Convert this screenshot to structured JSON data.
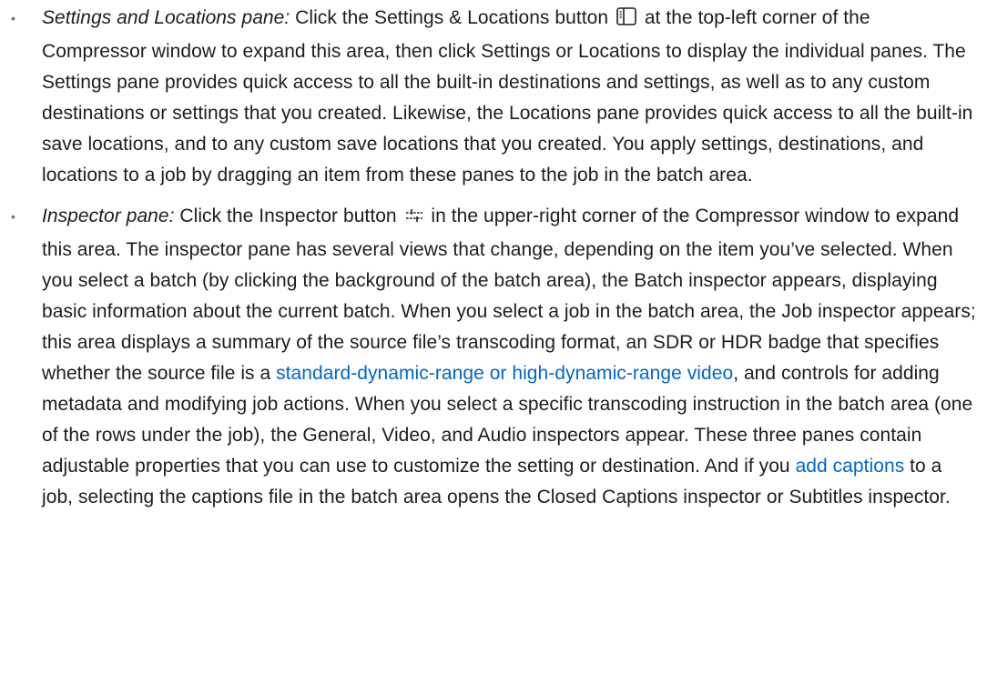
{
  "bullet": "•",
  "items": [
    {
      "term": "Settings and Locations pane:",
      "text_before_icon": " Click the Settings & Locations button ",
      "icon": "sidebar-toggle-icon",
      "text_after_icon": " at the top-left corner of the Compressor window to expand this area, then click Settings or Locations to display the individual panes. The Settings pane provides quick access to all the built-in destinations and settings, as well as to any custom destinations or settings that you created. Likewise, the Locations pane provides quick access to all the built-in save locations, and to any custom save locations that you created. You apply settings, destinations, and locations to a job by dragging an item from these panes to the job in the batch area."
    },
    {
      "term": "Inspector pane:",
      "text_before_icon": " Click the Inspector button ",
      "icon": "inspector-sliders-icon",
      "text_after_icon": " in the upper-right corner of the Compressor window to expand this area. The inspector pane has several views that change, depending on the item you’ve selected. When you select a batch (by clicking the background of the batch area), the Batch inspector appears, displaying basic information about the current batch. When you select a job in the batch area, the Job inspector appears; this area displays a summary of the source file’s transcoding format, an SDR or HDR badge that specifies whether the source file is a ",
      "link1": "standard-dynamic-range or high-dynamic-range video",
      "text_after_link1": ", and controls for adding metadata and modifying job actions. When you select a specific transcoding instruction in the batch area (one of the rows under the job), the General, Video, and Audio inspectors appear. These three panes contain adjustable properties that you can use to customize the setting or destination. And if you ",
      "link2": "add captions",
      "text_after_link2": " to a job, selecting the captions file in the batch area opens the Closed Captions inspector or Subtitles inspector."
    }
  ],
  "colors": {
    "text": "#1d1d1f",
    "link": "#0066cc",
    "bullet": "#6e6e73"
  }
}
